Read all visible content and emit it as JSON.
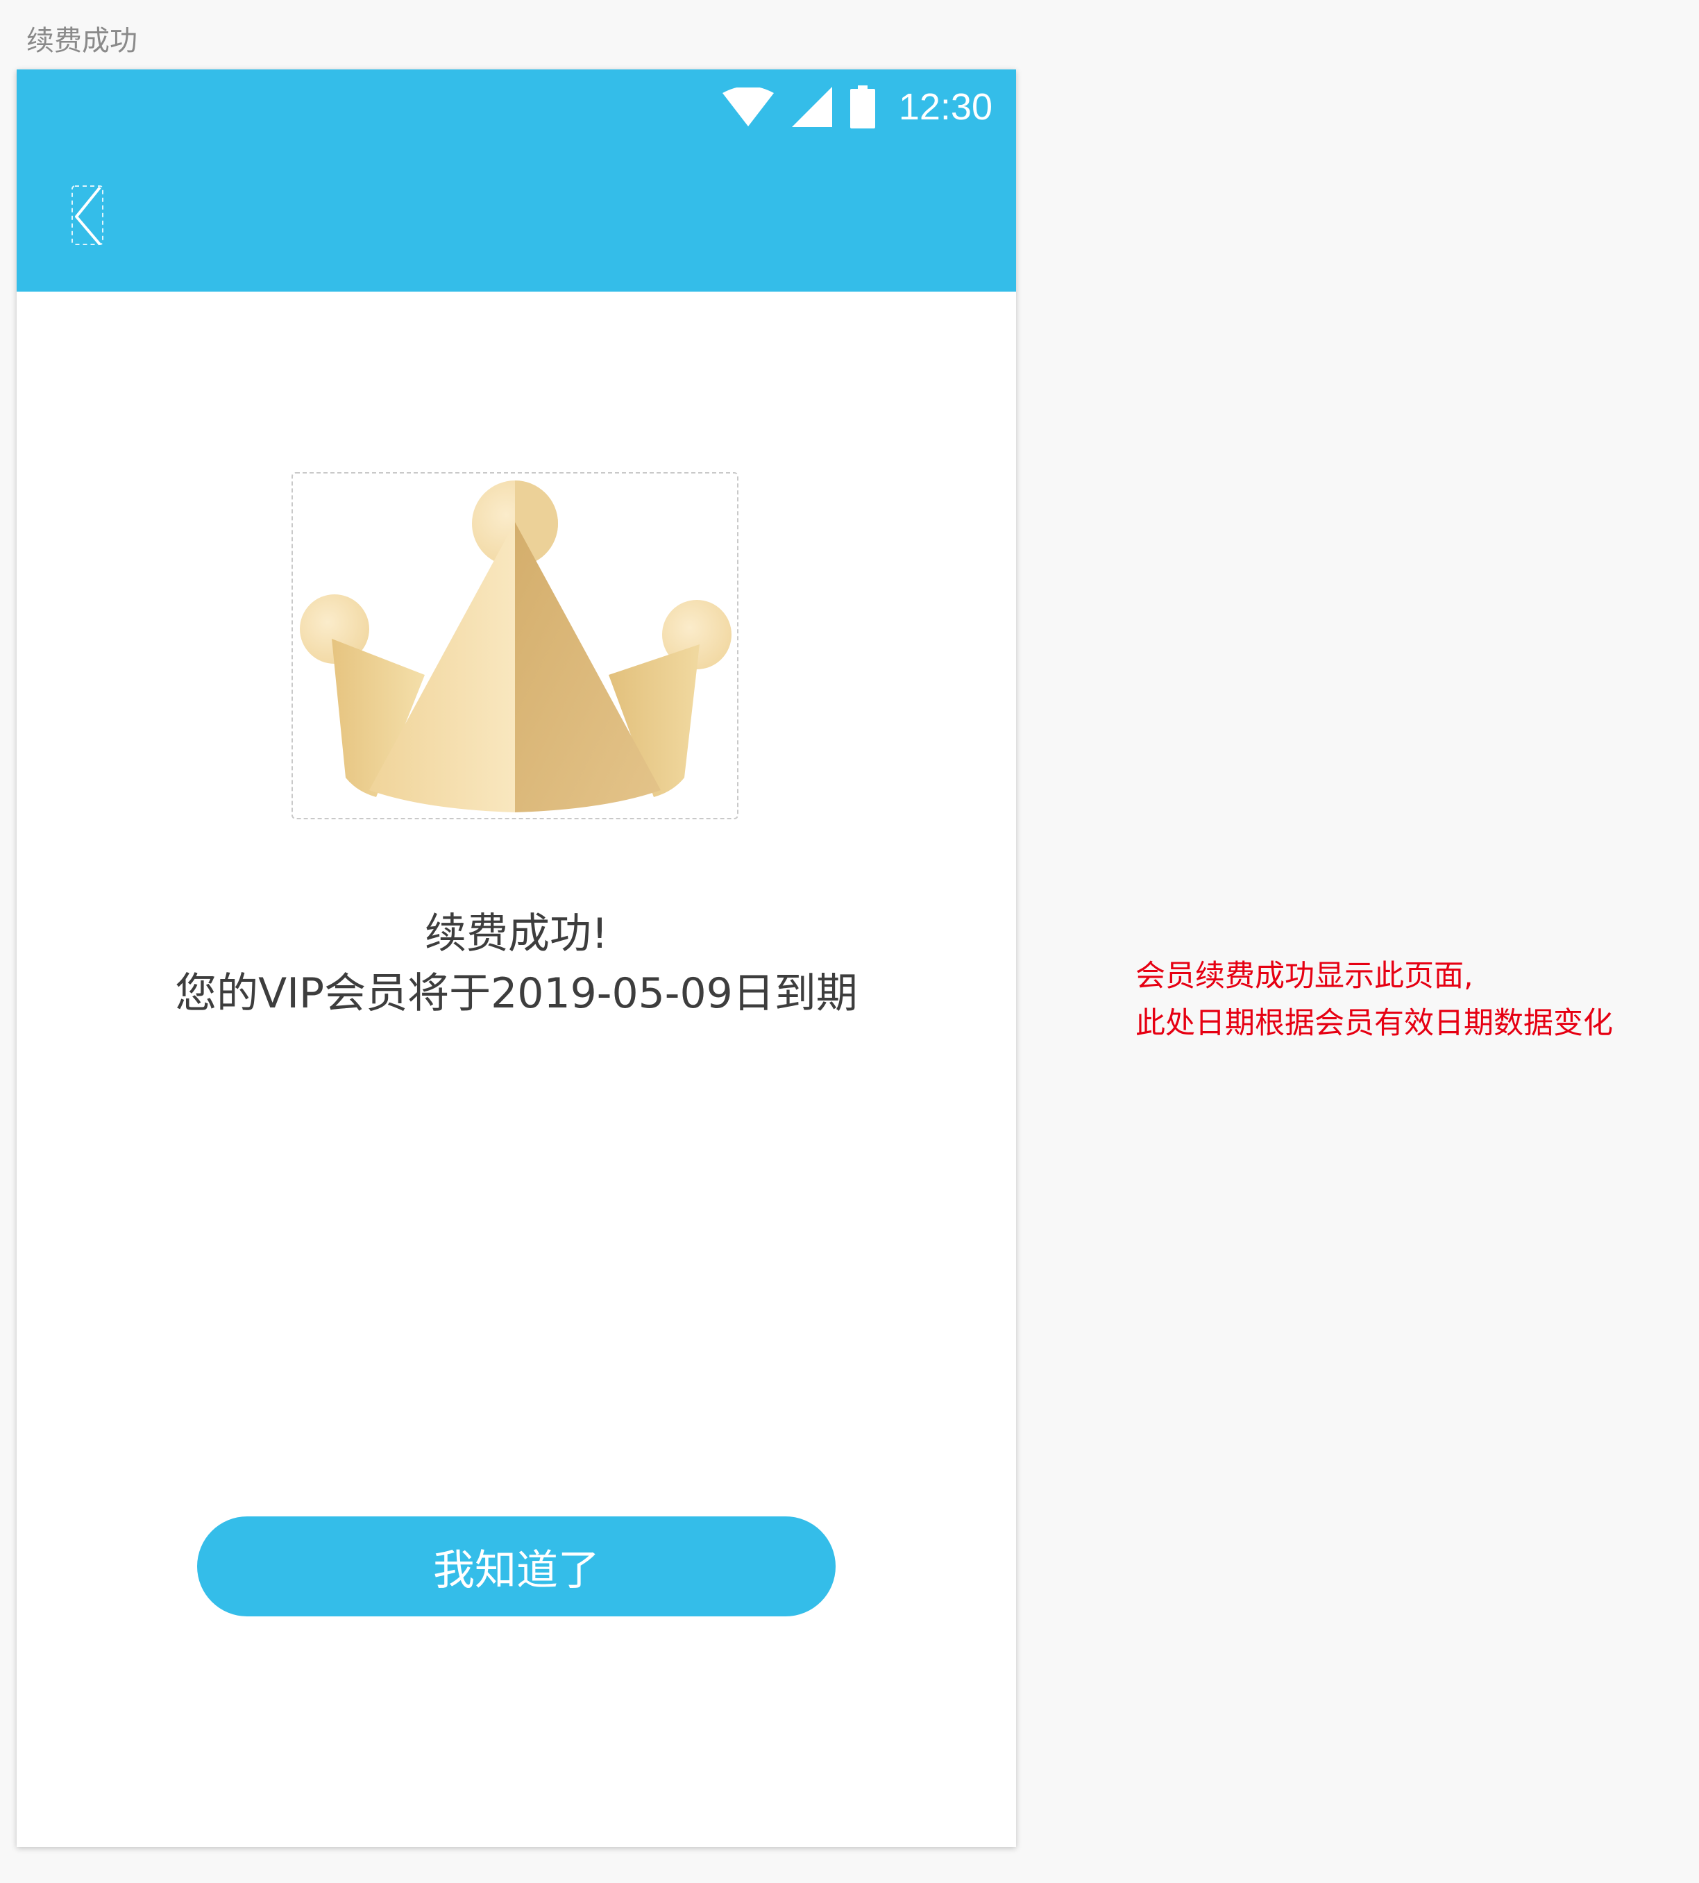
{
  "page": {
    "title": "续费成功"
  },
  "status_bar": {
    "time": "12:30",
    "icons": [
      "wifi-icon",
      "signal-icon",
      "battery-icon"
    ]
  },
  "toolbar": {
    "back_icon": "chevron-left-icon"
  },
  "content": {
    "illustration": "crown-icon",
    "title": "续费成功!",
    "expiry_message": "您的VIP会员将于2019-05-09日到期",
    "confirm_button_label": "我知道了"
  },
  "annotation": {
    "line1": "会员续费成功显示此页面,",
    "line2": "此处日期根据会员有效日期数据变化"
  },
  "colors": {
    "primary": "#34BDE9",
    "background": "#F8F8F8",
    "annotation": "#E60012",
    "crown_gold": "#E8CC8C"
  }
}
